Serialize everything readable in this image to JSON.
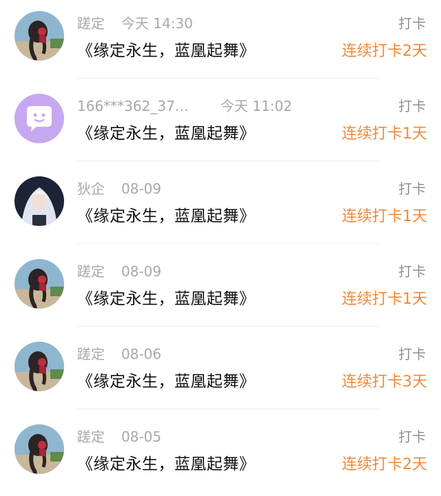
{
  "colors": {
    "accent": "#ee8a3a",
    "meta_text": "#a8a8a8",
    "title_text": "#111111",
    "chat_avatar_bg": "#c6a8f1"
  },
  "items": [
    {
      "avatar": "girl-braid",
      "name": "蹉定",
      "time": "今天 14:30",
      "action": "打卡",
      "title": "《缘定永生，蓝凰起舞》",
      "streak": "连续打卡2天"
    },
    {
      "avatar": "chat-bubble",
      "name": "166***362_37…",
      "time": "今天 11:02",
      "action": "打卡",
      "title": "《缘定永生，蓝凰起舞》",
      "streak": "连续打卡1天"
    },
    {
      "avatar": "white-hair-character",
      "name": "狄企",
      "time": "08-09",
      "action": "打卡",
      "title": "《缘定永生，蓝凰起舞》",
      "streak": "连续打卡1天"
    },
    {
      "avatar": "girl-braid",
      "name": "蹉定",
      "time": "08-09",
      "action": "打卡",
      "title": "《缘定永生，蓝凰起舞》",
      "streak": "连续打卡1天"
    },
    {
      "avatar": "girl-braid",
      "name": "蹉定",
      "time": "08-06",
      "action": "打卡",
      "title": "《缘定永生，蓝凰起舞》",
      "streak": "连续打卡3天"
    },
    {
      "avatar": "girl-braid",
      "name": "蹉定",
      "time": "08-05",
      "action": "打卡",
      "title": "《缘定永生，蓝凰起舞》",
      "streak": "连续打卡2天"
    }
  ]
}
